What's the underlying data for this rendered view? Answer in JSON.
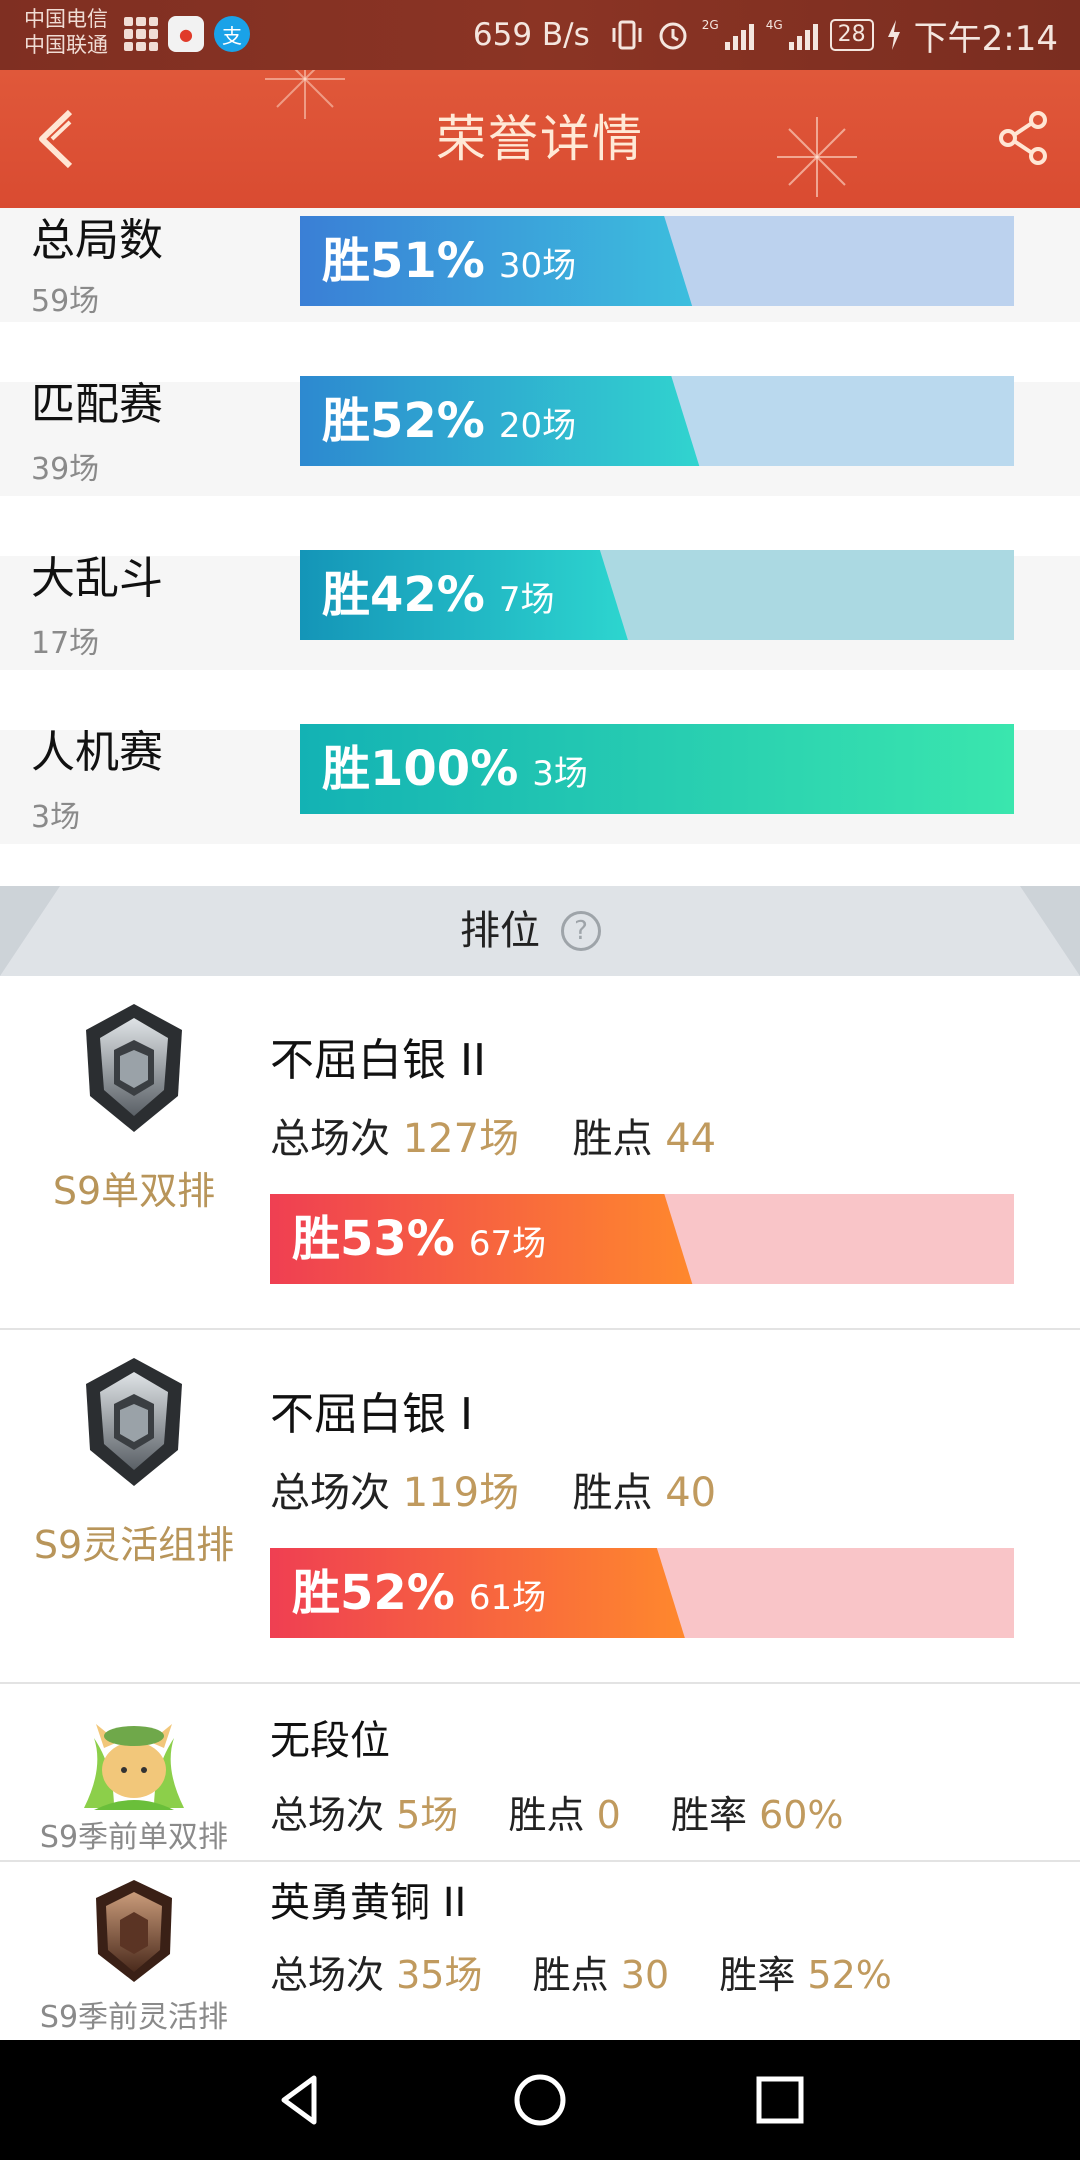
{
  "status_bar": {
    "carrier_1": "中国电信",
    "carrier_2": "中国联通",
    "net_speed": "659 B/s",
    "net_1": "2G",
    "net_2": "4G",
    "battery": "28",
    "time": "下午2:14"
  },
  "header": {
    "title": "荣誉详情"
  },
  "stats": [
    {
      "label": "总局数",
      "sub": "59场",
      "pct": "胜51%",
      "count": "30场",
      "win_rate": 0.51,
      "colors": [
        "#3a7fd6",
        "#3cc0de"
      ],
      "track": "#bcd2ee"
    },
    {
      "label": "匹配赛",
      "sub": "39场",
      "pct": "胜52%",
      "count": "20场",
      "win_rate": 0.52,
      "colors": [
        "#2d89d0",
        "#31d6cf"
      ],
      "track": "#bad9ee"
    },
    {
      "label": "大乱斗",
      "sub": "17场",
      "pct": "胜42%",
      "count": "7场",
      "win_rate": 0.42,
      "colors": [
        "#1495b8",
        "#2ed8d0"
      ],
      "track": "#abd9e2"
    },
    {
      "label": "人机赛",
      "sub": "3场",
      "pct": "胜100%",
      "count": "3场",
      "win_rate": 1.0,
      "colors": [
        "#13b2b4",
        "#3ae6ae"
      ],
      "track": "#b7ece1"
    }
  ],
  "ranked": {
    "title": "排位",
    "help": "?",
    "total_label": "总场次",
    "points_label": "胜点",
    "rate_label": "胜率",
    "main": [
      {
        "season": "S9单双排",
        "rank": "不屈白银 II",
        "total": "127场",
        "points": "44",
        "pct": "胜53%",
        "count": "67场",
        "win_rate": 0.53
      },
      {
        "season": "S9灵活组排",
        "rank": "不屈白银 I",
        "total": "119场",
        "points": "40",
        "pct": "胜52%",
        "count": "61场",
        "win_rate": 0.52
      }
    ],
    "preseason": [
      {
        "season": "S9季前单双排",
        "rank": "无段位",
        "total": "5场",
        "points": "0",
        "rate": "60%"
      },
      {
        "season": "S9季前灵活排",
        "rank": "英勇黄铜 II",
        "total": "35场",
        "points": "30",
        "rate": "52%"
      }
    ]
  },
  "nav": {
    "icons": [
      "back-triangle-icon",
      "home-circle-icon",
      "recents-square-icon"
    ]
  }
}
